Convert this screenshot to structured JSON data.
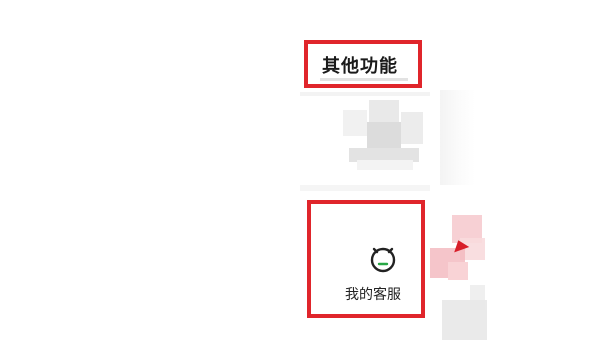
{
  "section": {
    "title": "其他功能"
  },
  "service": {
    "label": "我的客服",
    "icon": "customer-service-robot-icon"
  },
  "colors": {
    "highlight_border": "#e0252b",
    "icon_accent": "#28a745",
    "text": "#222222"
  }
}
